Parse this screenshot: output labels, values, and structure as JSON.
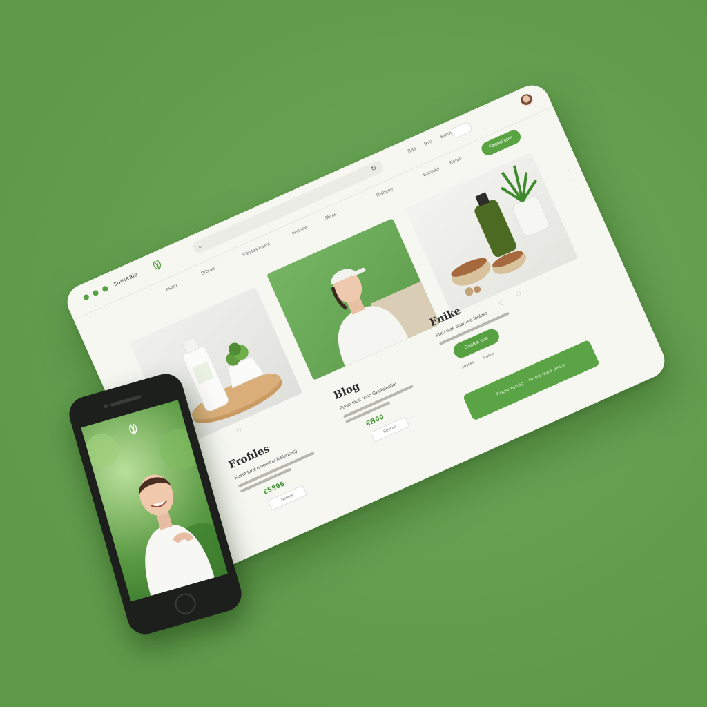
{
  "desktop": {
    "brand": "sueteaie",
    "logo_caption": "esteo",
    "nav": [
      "Brbrae",
      "Fibates eaam",
      "eeueew",
      "Sbrae",
      "Rlsheee",
      "Bubsasi",
      "Eerun"
    ],
    "top_links": [
      "Bas",
      "Bvs",
      "Brem"
    ],
    "cta_label": "Faanni seer",
    "products": {
      "title": "Frofiles",
      "desc": "Fuant tunit u ooerlhu (usleusas)",
      "price": "€5895",
      "button": "Seneat"
    },
    "blog": {
      "title": "Blog",
      "desc": "Fuact mun, wnh Geehneulier",
      "price": "€B00",
      "button": "Sevcas"
    },
    "profile": {
      "title": "Fnike",
      "desc": "Furu ouw ooenvee leulner",
      "button": "Gaaroc ooa",
      "link_a": "sosees",
      "link_b": "Funcs"
    },
    "big_cta": "Fouw tunag · ro ouuaeu eeue"
  },
  "colors": {
    "accent": "#59a343",
    "background": "#64a24e",
    "panel": "#f7f7f2"
  }
}
